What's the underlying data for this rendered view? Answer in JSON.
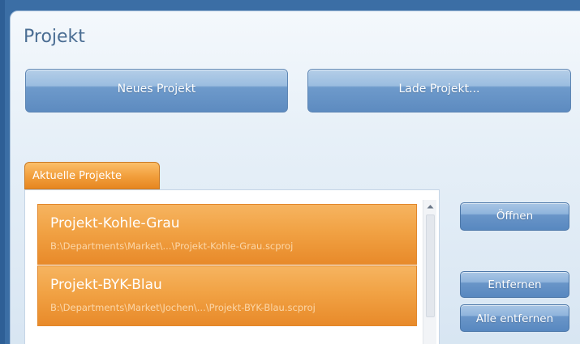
{
  "colors": {
    "window_blue": "#3b6ea5",
    "panel_bg": "#e7f0f8",
    "title_text": "#4a6d93",
    "button_blue": "#5d8bc0",
    "orange_accent": "#f1a244",
    "path_text": "#fbd7a9"
  },
  "page": {
    "title": "Projekt"
  },
  "actions": {
    "new_project_label": "Neues Projekt",
    "load_project_label": "Lade Projekt..."
  },
  "tab": {
    "label": "Aktuelle Projekte"
  },
  "projects": [
    {
      "name": "Projekt-Kohle-Grau",
      "path": "B:\\Departments\\Market\\...\\Projekt-Kohle-Grau.scproj"
    },
    {
      "name": "Projekt-BYK-Blau",
      "path": "B:\\Departments\\Market\\Jochen\\...\\Projekt-BYK-Blau.scproj"
    }
  ],
  "side_actions": {
    "open_label": "Öffnen",
    "remove_label": "Entfernen",
    "remove_all_label": "Alle entfernen"
  },
  "icons": {
    "scroll_up": "chevron-up-icon"
  }
}
